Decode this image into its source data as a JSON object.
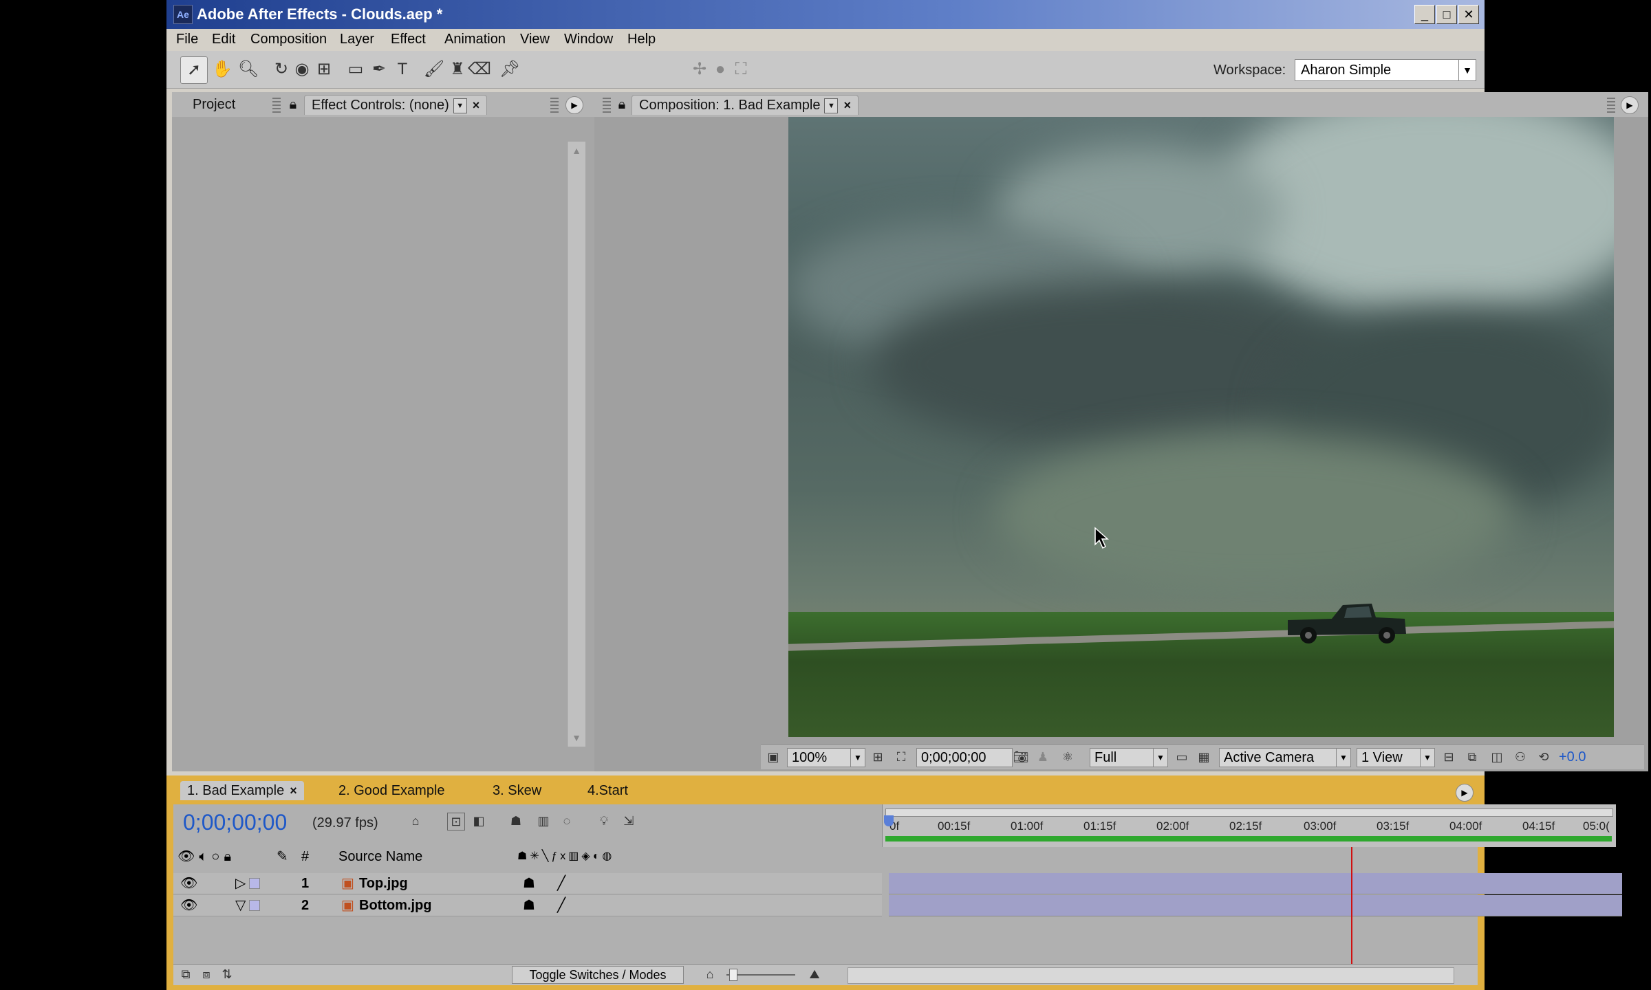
{
  "window": {
    "app_icon": "Ae",
    "title": "Adobe After Effects - Clouds.aep *",
    "buttons": {
      "minimize": "_",
      "maximize": "□",
      "close": "✕"
    }
  },
  "menu": [
    "File",
    "Edit",
    "Composition",
    "Layer",
    "Effect",
    "Animation",
    "View",
    "Window",
    "Help"
  ],
  "toolbar": {
    "workspace_label": "Workspace:",
    "workspace_value": "Aharon Simple"
  },
  "left_panel": {
    "tab_project": "Project",
    "tab_effect_controls": "Effect Controls: (none)"
  },
  "comp_panel": {
    "tab_label": "Composition: 1. Bad Example",
    "zoom": "100%",
    "timecode": "0;00;00;00",
    "resolution": "Full",
    "camera": "Active Camera",
    "views": "1 View",
    "exposure": "+0.0"
  },
  "timeline": {
    "tabs": [
      "1. Bad Example",
      "2. Good Example",
      "3. Skew",
      "4.Start"
    ],
    "timecode": "0;00;00;00",
    "fps": "(29.97 fps)",
    "col_number": "#",
    "col_source": "Source Name",
    "ruler": [
      "0f",
      "00:15f",
      "01:00f",
      "01:15f",
      "02:00f",
      "02:15f",
      "03:00f",
      "03:15f",
      "04:00f",
      "04:15f",
      "05:0("
    ],
    "layers": [
      {
        "num": "1",
        "name": "Top.jpg"
      },
      {
        "num": "2",
        "name": "Bottom.jpg"
      }
    ],
    "toggle_button": "Toggle Switches / Modes"
  },
  "colors": {
    "timecode_blue": "#1e58c8",
    "timeline_border": "#e0b040",
    "work_area": "#2ea82e",
    "current_time_indicator": "#d01010"
  }
}
